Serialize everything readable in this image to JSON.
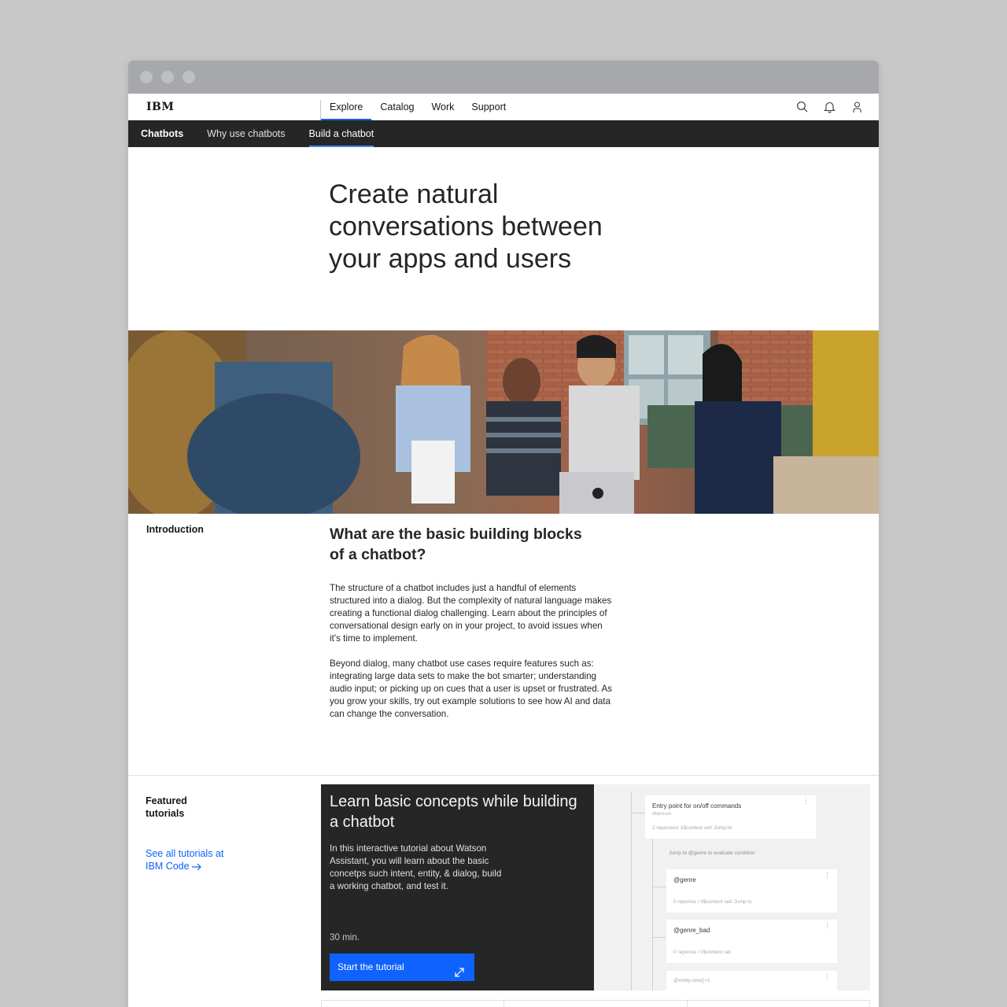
{
  "masthead": {
    "logo": "IBM",
    "nav": [
      "Explore",
      "Catalog",
      "Work",
      "Support"
    ],
    "icons": [
      "search-icon",
      "notification-icon",
      "user-icon"
    ]
  },
  "subnav": {
    "brand": "Chatbots",
    "items": [
      "Why use chatbots",
      "Build a chatbot"
    ]
  },
  "hero": {
    "title": "Create natural conversations between your apps and users"
  },
  "intro": {
    "label": "Introduction",
    "heading": "What are the basic building blocks of a chatbot?",
    "p1": "The structure of a chatbot includes just a handful of elements structured into a dialog.  But the complexity of natural language makes creating a functional dialog challenging.  Learn about the principles of conversational design early on in your project, to avoid issues when it’s time to implement.",
    "p2": "Beyond dialog, many chatbot use cases require features such as: integrating large data sets to make the bot smarter; understanding audio input; or picking up on cues that a user is upset or frustrated.  As you grow your skills, try out example solutions to see how AI and data can change the conversation."
  },
  "featured": {
    "label": "Featured tutorials",
    "link": "See all tutorials at IBM Code",
    "card": {
      "title": "Learn basic concepts while building a chatbot",
      "description": "In this interactive tutorial about Watson Assistant, you will learn about the basic concetps such intent, entity, & dialog, build a working chatbot, and test it.",
      "duration": "30 min.",
      "button": "Start the tutorial"
    },
    "preview": {
      "node1_title": "Entry point for on/off commands",
      "node1_tag": "#turn-on",
      "node1_sub": "2 reponses/ 1$context set/ Jump-to",
      "branch_label": "Jump to @genre to evaluate condition",
      "node2_title": "@genre",
      "node2_sub": "0 reponse / 0$context set/ Jump to",
      "node3_title": "@genre_bad",
      "node3_sub": "0 reponse / 0$context set",
      "node4_title": "@entity.size()>1"
    }
  },
  "colors": {
    "accent": "#0f62fe",
    "dark": "#262626",
    "window_chrome": "#a6a8ab",
    "background": "#c8c8c8"
  }
}
